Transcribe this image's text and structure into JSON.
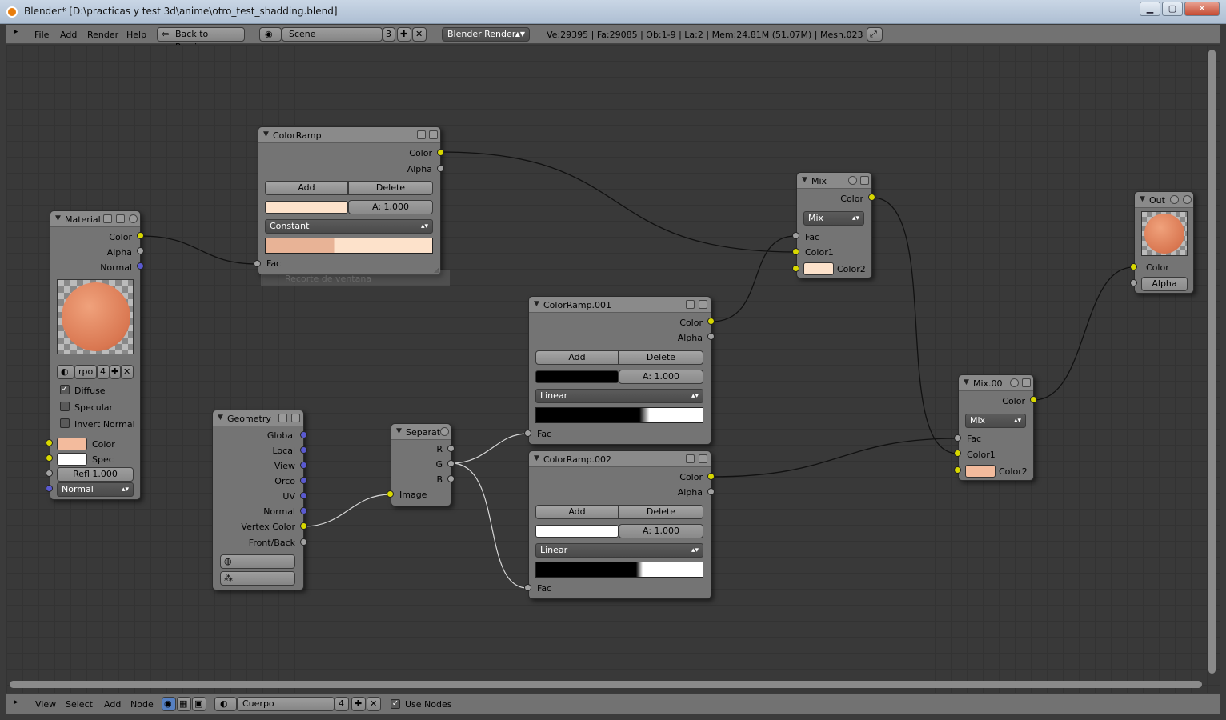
{
  "window": {
    "title": "Blender* [D:\\practicas y test 3d\\anime\\otro_test_shadding.blend]",
    "min": "▁",
    "max": "▢",
    "close": "✕"
  },
  "header": {
    "menus": [
      "File",
      "Add",
      "Render",
      "Help"
    ],
    "back_label": "Back to Previous",
    "scene_name": "Scene",
    "scene_users": "3",
    "engine": "Blender Render",
    "stats": "Ve:29395 | Fa:29085 | Ob:1-9 | La:2 | Mem:24.81M (51.07M) | Mesh.023"
  },
  "footer": {
    "menus": [
      "View",
      "Select",
      "Add",
      "Node"
    ],
    "material_name": "Cuerpo",
    "material_users": "4",
    "use_nodes": "Use Nodes"
  },
  "colors": {
    "skin": "#f3bb9d",
    "peach": "#fde2cb",
    "accent_yellow": "#d8d800"
  },
  "nodes": {
    "colorramp": {
      "title": "ColorRamp",
      "out_color": "Color",
      "out_alpha": "Alpha",
      "add": "Add",
      "delete": "Delete",
      "alpha": "A: 1.000",
      "interp": "Constant",
      "in_fac": "Fac",
      "tooltip": "Recorte de ventana"
    },
    "material": {
      "title": "Material",
      "out_color": "Color",
      "out_alpha": "Alpha",
      "out_normal": "Normal",
      "mat_name": "rpo",
      "mat_users": "4",
      "diffuse": "Diffuse",
      "specular": "Specular",
      "invert_normal": "Invert Normal",
      "in_color": "Color",
      "in_spec": "Spec",
      "refl": "Refl 1.000",
      "normal_sel": "Normal"
    },
    "geometry": {
      "title": "Geometry",
      "outs": [
        "Global",
        "Local",
        "View",
        "Orco",
        "UV",
        "Normal",
        "Vertex Color",
        "Front/Back"
      ]
    },
    "separate": {
      "title": "Separat",
      "outs": [
        "R",
        "G",
        "B"
      ],
      "in_image": "Image"
    },
    "ramp001": {
      "title": "ColorRamp.001",
      "out_color": "Color",
      "out_alpha": "Alpha",
      "add": "Add",
      "delete": "Delete",
      "alpha": "A: 1.000",
      "interp": "Linear",
      "in_fac": "Fac"
    },
    "ramp002": {
      "title": "ColorRamp.002",
      "out_color": "Color",
      "out_alpha": "Alpha",
      "add": "Add",
      "delete": "Delete",
      "alpha": "A: 1.000",
      "interp": "Linear",
      "in_fac": "Fac"
    },
    "mix": {
      "title": "Mix",
      "out_color": "Color",
      "blend": "Mix",
      "in_fac": "Fac",
      "in_color1": "Color1",
      "in_color2": "Color2"
    },
    "mix00": {
      "title": "Mix.00",
      "out_color": "Color",
      "blend": "Mix",
      "in_fac": "Fac",
      "in_color1": "Color1",
      "in_color2": "Color2"
    },
    "output": {
      "title": "Out",
      "in_color": "Color",
      "alpha": "Alpha"
    }
  }
}
